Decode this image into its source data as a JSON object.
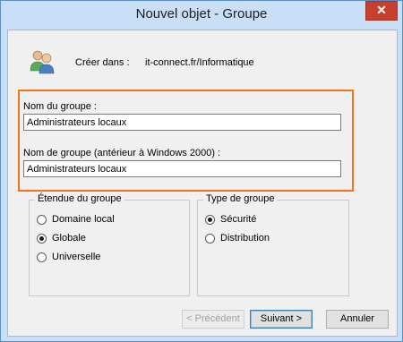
{
  "window": {
    "title": "Nouvel objet - Groupe",
    "close_glyph": "✕"
  },
  "header": {
    "create_in_label": "Créer dans :",
    "create_in_value": "it-connect.fr/Informatique",
    "icon": "users-icon"
  },
  "form": {
    "group_name_label": "Nom du groupe :",
    "group_name_value": "Administrateurs locaux",
    "pre2000_label": "Nom de groupe (antérieur à Windows 2000) :",
    "pre2000_value": "Administrateurs locaux"
  },
  "scope": {
    "title": "Étendue du groupe",
    "options": [
      {
        "label": "Domaine local",
        "checked": false
      },
      {
        "label": "Globale",
        "checked": true
      },
      {
        "label": "Universelle",
        "checked": false
      }
    ]
  },
  "type": {
    "title": "Type de groupe",
    "options": [
      {
        "label": "Sécurité",
        "checked": true
      },
      {
        "label": "Distribution",
        "checked": false
      }
    ]
  },
  "buttons": {
    "previous": "< Précédent",
    "next": "Suivant >",
    "cancel": "Annuler"
  },
  "colors": {
    "highlight": "#f0761b",
    "frame": "#c9dff7",
    "close": "#c7402f"
  }
}
